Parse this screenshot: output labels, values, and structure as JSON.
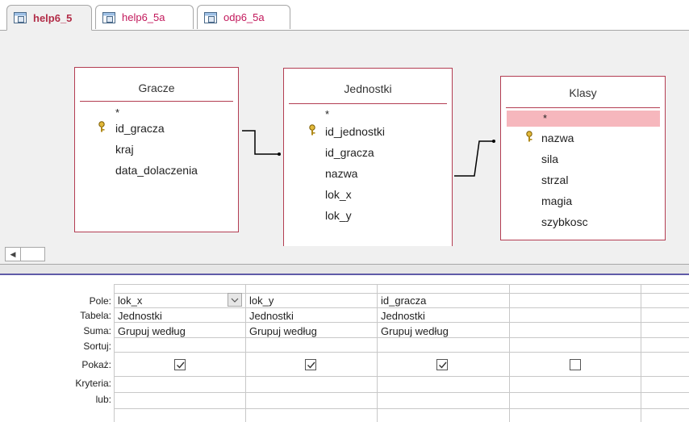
{
  "tabs": [
    {
      "label": "help6_5",
      "active": true
    },
    {
      "label": "help6_5a",
      "active": false
    },
    {
      "label": "odp6_5a",
      "active": false
    }
  ],
  "tables": {
    "gracze": {
      "title": "Gracze",
      "fields": [
        "*",
        "id_gracza",
        "kraj",
        "data_dolaczenia"
      ]
    },
    "jednostki": {
      "title": "Jednostki",
      "fields": [
        "*",
        "id_jednostki",
        "id_gracza",
        "nazwa",
        "lok_x",
        "lok_y"
      ]
    },
    "klasy": {
      "title": "Klasy",
      "fields": [
        "*",
        "nazwa",
        "sila",
        "strzal",
        "magia",
        "szybkosc"
      ]
    }
  },
  "grid": {
    "row_labels": [
      "Pole:",
      "Tabela:",
      "Suma:",
      "Sortuj:",
      "Pokaż:",
      "Kryteria:",
      "lub:"
    ],
    "columns": [
      {
        "pole": "lok_x",
        "tabela": "Jednostki",
        "suma": "Grupuj według",
        "pokaz": true
      },
      {
        "pole": "lok_y",
        "tabela": "Jednostki",
        "suma": "Grupuj według",
        "pokaz": true
      },
      {
        "pole": "id_gracza",
        "tabela": "Jednostki",
        "suma": "Grupuj według",
        "pokaz": true
      },
      {
        "pole": "",
        "tabela": "",
        "suma": "",
        "pokaz": false
      }
    ]
  },
  "colors": {
    "accent": "#b33d52",
    "highlight": "#f6b7bd",
    "splitter": "#5f5aa8"
  }
}
